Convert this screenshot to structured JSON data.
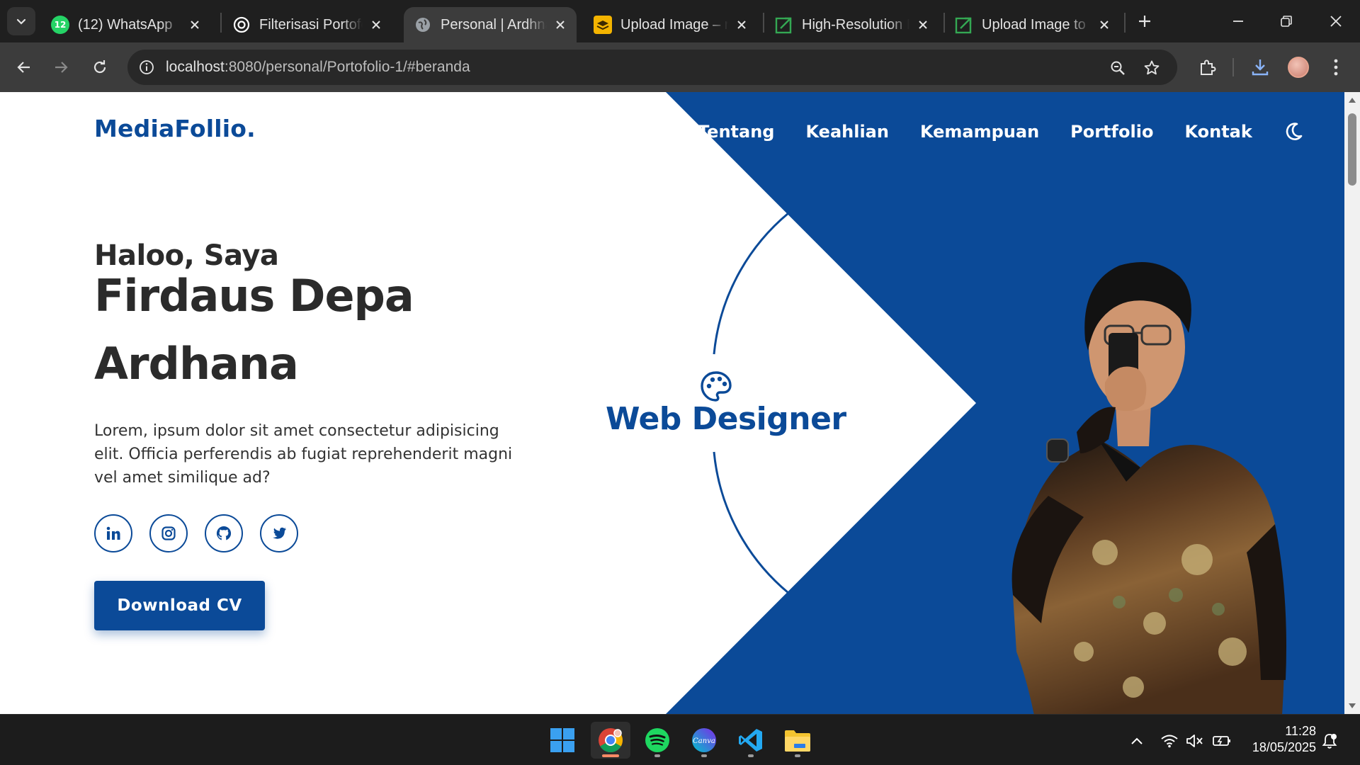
{
  "browser": {
    "tabs": [
      {
        "title": "(12) WhatsApp",
        "badge": "12",
        "favicon": "whatsapp-icon",
        "color": "#25d366"
      },
      {
        "title": "Filterisasi Portofolio",
        "favicon": "openai-icon",
        "color": "#ffffff"
      },
      {
        "title": "Personal | Ardhna",
        "favicon": "globe-icon",
        "color": "#9aa0a6"
      },
      {
        "title": "Upload Image – re",
        "favicon": "upload-stack-icon",
        "color": "#f4b400"
      },
      {
        "title": "High-Resolution In",
        "favicon": "image-upscale-icon",
        "color": "#34a853"
      },
      {
        "title": "Upload Image to E",
        "favicon": "image-upscale-icon",
        "color": "#34a853"
      }
    ],
    "active_tab_index": 2,
    "url_host": "localhost",
    "url_rest": ":8080/personal/Portofolio-1/#beranda"
  },
  "site": {
    "brand": "MediaFollio.",
    "nav": [
      "Tentang",
      "Keahlian",
      "Kemampuan",
      "Portfolio",
      "Kontak"
    ],
    "greeting": "Haloo, Saya",
    "name": "Firdaus Depa Ardhana",
    "bio": "Lorem, ipsum dolor sit amet consectetur adipisicing elit. Officia perferendis ab fugiat reprehenderit magni vel amet similique ad?",
    "socials": [
      "linkedin-icon",
      "instagram-icon",
      "github-icon",
      "twitter-icon"
    ],
    "cta": "Download CV",
    "role": "Web Designer",
    "accent": "#0b4a98"
  },
  "taskbar": {
    "apps": [
      "windows-start-icon",
      "chrome-icon",
      "spotify-icon",
      "canva-icon",
      "vscode-icon",
      "file-explorer-icon"
    ],
    "time": "11:28",
    "date": "18/05/2025"
  }
}
